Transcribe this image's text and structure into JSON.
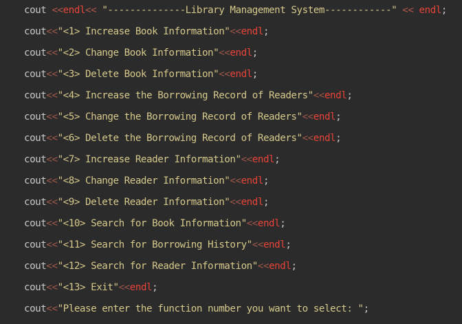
{
  "editor": {
    "lines": [
      {
        "cout": "cout",
        "op1": " <<",
        "endl1": "endl",
        "op2": "<< ",
        "str": "\"--------------Library Management System------------\"",
        "op3": " << ",
        "endl2": "endl",
        "semi": ";"
      },
      {
        "cout": "cout",
        "op": "<<",
        "str": "\"<1> Increase Book Information\"",
        "op2": "<<",
        "endl": "endl",
        "semi": ";"
      },
      {
        "cout": "cout",
        "op": "<<",
        "str": "\"<2> Change Book Information\"",
        "op2": "<<",
        "endl": "endl",
        "semi": ";"
      },
      {
        "cout": "cout",
        "op": "<<",
        "str": "\"<3> Delete Book Information\"",
        "op2": "<<",
        "endl": "endl",
        "semi": ";"
      },
      {
        "cout": "cout",
        "op": "<<",
        "str": "\"<4> Increase the Borrowing Record of Readers\"",
        "op2": "<<",
        "endl": "endl",
        "semi": ";"
      },
      {
        "cout": "cout",
        "op": "<<",
        "str": "\"<5> Change the Borrowing Record of Readers\"",
        "op2": "<<",
        "endl": "endl",
        "semi": ";"
      },
      {
        "cout": "cout",
        "op": "<<",
        "str": "\"<6> Delete the Borrowing Record of Readers\"",
        "op2": "<<",
        "endl": "endl",
        "semi": ";"
      },
      {
        "cout": "cout",
        "op": "<<",
        "str": "\"<7> Increase Reader Information\"",
        "op2": "<<",
        "endl": "endl",
        "semi": ";"
      },
      {
        "cout": "cout",
        "op": "<<",
        "str": "\"<8> Change Reader Information\"",
        "op2": "<<",
        "endl": "endl",
        "semi": ";"
      },
      {
        "cout": "cout",
        "op": "<<",
        "str": "\"<9> Delete Reader Information\"",
        "op2": "<<",
        "endl": "endl",
        "semi": ";"
      },
      {
        "cout": "cout",
        "op": "<<",
        "str": "\"<10> Search for Book Information\"",
        "op2": "<<",
        "endl": "endl",
        "semi": ";"
      },
      {
        "cout": "cout",
        "op": "<<",
        "str": "\"<11> Search for Borrowing History\"",
        "op2": "<<",
        "endl": "endl",
        "semi": ";"
      },
      {
        "cout": "cout",
        "op": "<<",
        "str": "\"<12> Search for Reader Information\"",
        "op2": "<<",
        "endl": "endl",
        "semi": ";"
      },
      {
        "cout": "cout",
        "op": "<<",
        "str": "\"<13> Exit\"",
        "op2": "<<",
        "endl": "endl",
        "semi": ";"
      },
      {
        "cout": "cout",
        "op": "<<",
        "str": "\"Please enter the function number you want to select: \"",
        "semi": ";"
      }
    ]
  }
}
